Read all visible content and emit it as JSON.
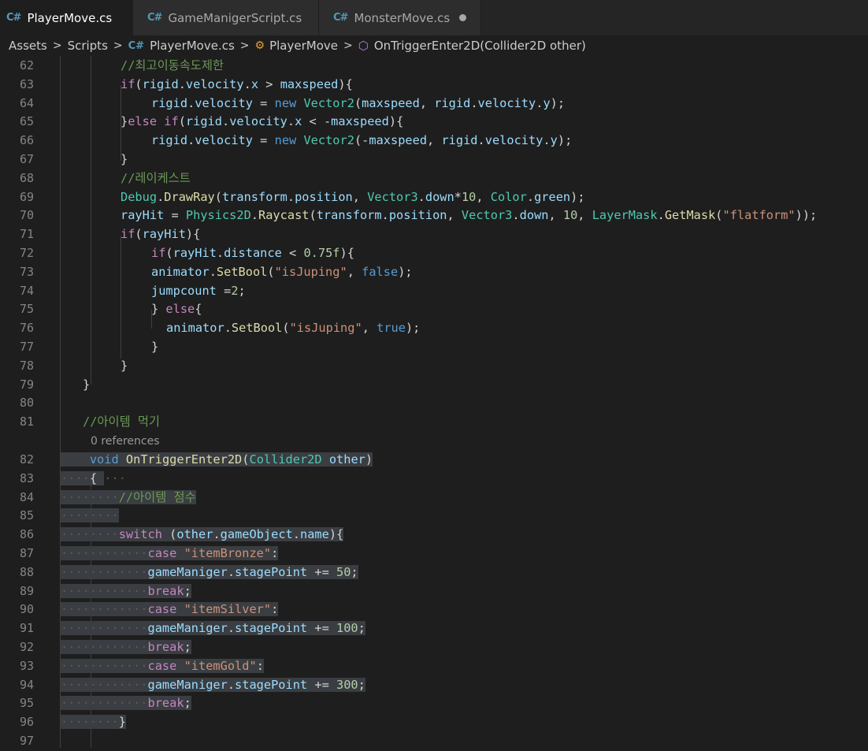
{
  "tabs": [
    {
      "label": "PlayerMove.cs",
      "icon": "csharp-icon",
      "active": true,
      "modified": true
    },
    {
      "label": "GameManigerScript.cs",
      "icon": "csharp-icon",
      "active": false,
      "modified": false
    },
    {
      "label": "MonsterMove.cs",
      "icon": "csharp-icon",
      "active": false,
      "modified": true
    }
  ],
  "breadcrumb": {
    "items": [
      "Assets",
      "Scripts",
      "PlayerMove.cs",
      "PlayerMove",
      "OnTriggerEnter2D(Collider2D other)"
    ]
  },
  "codelens": "0 references",
  "colors": {
    "keyword": "#c586c0",
    "keyword_blue": "#569cd6",
    "type": "#4ec9b0",
    "function": "#dcdcaa",
    "variable": "#9cdcfe",
    "string": "#ce9178",
    "number": "#b5cea8",
    "comment": "#6a9955",
    "selection": "#3a3d41"
  },
  "lines": [
    {
      "n": "62",
      "t": [
        [
          "c",
          "//최고이동속도제한"
        ]
      ]
    },
    {
      "n": "63",
      "t": [
        [
          "k",
          "if"
        ],
        [
          "p",
          "("
        ],
        [
          "v",
          "rigid"
        ],
        [
          "p",
          "."
        ],
        [
          "v",
          "velocity"
        ],
        [
          "p",
          "."
        ],
        [
          "v",
          "x"
        ],
        [
          "p",
          " > "
        ],
        [
          "v",
          "maxspeed"
        ],
        [
          "p",
          "){"
        ]
      ]
    },
    {
      "n": "64",
      "t": [
        [
          "v",
          "rigid"
        ],
        [
          "p",
          "."
        ],
        [
          "v",
          "velocity"
        ],
        [
          "p",
          " = "
        ],
        [
          "kb",
          "new"
        ],
        [
          "p",
          " "
        ],
        [
          "t",
          "Vector2"
        ],
        [
          "p",
          "("
        ],
        [
          "v",
          "maxspeed"
        ],
        [
          "p",
          ", "
        ],
        [
          "v",
          "rigid"
        ],
        [
          "p",
          "."
        ],
        [
          "v",
          "velocity"
        ],
        [
          "p",
          "."
        ],
        [
          "v",
          "y"
        ],
        [
          "p",
          ");"
        ]
      ]
    },
    {
      "n": "65",
      "t": [
        [
          "p",
          "}"
        ],
        [
          "k",
          "else"
        ],
        [
          "p",
          " "
        ],
        [
          "k",
          "if"
        ],
        [
          "p",
          "("
        ],
        [
          "v",
          "rigid"
        ],
        [
          "p",
          "."
        ],
        [
          "v",
          "velocity"
        ],
        [
          "p",
          "."
        ],
        [
          "v",
          "x"
        ],
        [
          "p",
          " < -"
        ],
        [
          "v",
          "maxspeed"
        ],
        [
          "p",
          "){"
        ]
      ]
    },
    {
      "n": "66",
      "t": [
        [
          "v",
          "rigid"
        ],
        [
          "p",
          "."
        ],
        [
          "v",
          "velocity"
        ],
        [
          "p",
          " = "
        ],
        [
          "kb",
          "new"
        ],
        [
          "p",
          " "
        ],
        [
          "t",
          "Vector2"
        ],
        [
          "p",
          "(-"
        ],
        [
          "v",
          "maxspeed"
        ],
        [
          "p",
          ", "
        ],
        [
          "v",
          "rigid"
        ],
        [
          "p",
          "."
        ],
        [
          "v",
          "velocity"
        ],
        [
          "p",
          "."
        ],
        [
          "v",
          "y"
        ],
        [
          "p",
          ");"
        ]
      ]
    },
    {
      "n": "67",
      "t": [
        [
          "p",
          "}"
        ]
      ]
    },
    {
      "n": "68",
      "t": [
        [
          "c",
          "//레이케스트"
        ]
      ]
    },
    {
      "n": "69",
      "t": [
        [
          "t",
          "Debug"
        ],
        [
          "p",
          "."
        ],
        [
          "f",
          "DrawRay"
        ],
        [
          "p",
          "("
        ],
        [
          "v",
          "transform"
        ],
        [
          "p",
          "."
        ],
        [
          "v",
          "position"
        ],
        [
          "p",
          ", "
        ],
        [
          "t",
          "Vector3"
        ],
        [
          "p",
          "."
        ],
        [
          "v",
          "down"
        ],
        [
          "p",
          "*"
        ],
        [
          "n",
          "10"
        ],
        [
          "p",
          ", "
        ],
        [
          "t",
          "Color"
        ],
        [
          "p",
          "."
        ],
        [
          "v",
          "green"
        ],
        [
          "p",
          ");"
        ]
      ]
    },
    {
      "n": "70",
      "t": [
        [
          "v",
          "rayHit"
        ],
        [
          "p",
          " = "
        ],
        [
          "t",
          "Physics2D"
        ],
        [
          "p",
          "."
        ],
        [
          "f",
          "Raycast"
        ],
        [
          "p",
          "("
        ],
        [
          "v",
          "transform"
        ],
        [
          "p",
          "."
        ],
        [
          "v",
          "position"
        ],
        [
          "p",
          ", "
        ],
        [
          "t",
          "Vector3"
        ],
        [
          "p",
          "."
        ],
        [
          "v",
          "down"
        ],
        [
          "p",
          ", "
        ],
        [
          "n",
          "10"
        ],
        [
          "p",
          ", "
        ],
        [
          "t",
          "LayerMask"
        ],
        [
          "p",
          "."
        ],
        [
          "f",
          "GetMask"
        ],
        [
          "p",
          "("
        ],
        [
          "s",
          "\"flatform\""
        ],
        [
          "p",
          "));"
        ]
      ]
    },
    {
      "n": "71",
      "t": [
        [
          "k",
          "if"
        ],
        [
          "p",
          "("
        ],
        [
          "v",
          "rayHit"
        ],
        [
          "p",
          "){"
        ]
      ]
    },
    {
      "n": "72",
      "t": [
        [
          "k",
          "if"
        ],
        [
          "p",
          "("
        ],
        [
          "v",
          "rayHit"
        ],
        [
          "p",
          "."
        ],
        [
          "v",
          "distance"
        ],
        [
          "p",
          " < "
        ],
        [
          "n",
          "0.75f"
        ],
        [
          "p",
          "){"
        ]
      ]
    },
    {
      "n": "73",
      "t": [
        [
          "v",
          "animator"
        ],
        [
          "p",
          "."
        ],
        [
          "f",
          "SetBool"
        ],
        [
          "p",
          "("
        ],
        [
          "s",
          "\"isJuping\""
        ],
        [
          "p",
          ", "
        ],
        [
          "kb",
          "false"
        ],
        [
          "p",
          ");"
        ]
      ]
    },
    {
      "n": "74",
      "t": [
        [
          "v",
          "jumpcount"
        ],
        [
          "p",
          " ="
        ],
        [
          "n",
          "2"
        ],
        [
          "p",
          ";"
        ]
      ]
    },
    {
      "n": "75",
      "t": [
        [
          "p",
          "} "
        ],
        [
          "k",
          "else"
        ],
        [
          "p",
          "{"
        ]
      ]
    },
    {
      "n": "76",
      "t": [
        [
          "v",
          "animator"
        ],
        [
          "p",
          "."
        ],
        [
          "f",
          "SetBool"
        ],
        [
          "p",
          "("
        ],
        [
          "s",
          "\"isJuping\""
        ],
        [
          "p",
          ", "
        ],
        [
          "kb",
          "true"
        ],
        [
          "p",
          ");"
        ]
      ]
    },
    {
      "n": "77",
      "t": [
        [
          "p",
          "}"
        ]
      ]
    },
    {
      "n": "78",
      "t": [
        [
          "p",
          "}"
        ]
      ]
    },
    {
      "n": "79",
      "t": [
        [
          "p",
          "}"
        ]
      ]
    },
    {
      "n": "80",
      "t": []
    },
    {
      "n": "81",
      "t": [
        [
          "c",
          "//아이템 먹기"
        ]
      ]
    },
    {
      "n": "82",
      "t": [
        [
          "kb",
          "void"
        ],
        [
          "p",
          " "
        ],
        [
          "f",
          "OnTriggerEnter2D"
        ],
        [
          "p",
          "("
        ],
        [
          "t",
          "Collider2D"
        ],
        [
          "p",
          " "
        ],
        [
          "v",
          "other"
        ],
        [
          "p",
          ")"
        ]
      ]
    },
    {
      "n": "83",
      "t": [
        [
          "p",
          "{"
        ]
      ]
    },
    {
      "n": "84",
      "t": [
        [
          "c",
          "//아이템 점수"
        ]
      ]
    },
    {
      "n": "85",
      "t": []
    },
    {
      "n": "86",
      "t": [
        [
          "k",
          "switch"
        ],
        [
          "p",
          " ("
        ],
        [
          "v",
          "other"
        ],
        [
          "p",
          "."
        ],
        [
          "v",
          "gameObject"
        ],
        [
          "p",
          "."
        ],
        [
          "v",
          "name"
        ],
        [
          "p",
          "){"
        ]
      ]
    },
    {
      "n": "87",
      "t": [
        [
          "k",
          "case"
        ],
        [
          "p",
          " "
        ],
        [
          "s",
          "\"itemBronze\""
        ],
        [
          "p",
          ":"
        ]
      ]
    },
    {
      "n": "88",
      "t": [
        [
          "v",
          "gameManiger"
        ],
        [
          "p",
          "."
        ],
        [
          "v",
          "stagePoint"
        ],
        [
          "p",
          " += "
        ],
        [
          "n",
          "50"
        ],
        [
          "p",
          ";"
        ]
      ]
    },
    {
      "n": "89",
      "t": [
        [
          "k",
          "break"
        ],
        [
          "p",
          ";"
        ]
      ]
    },
    {
      "n": "90",
      "t": [
        [
          "k",
          "case"
        ],
        [
          "p",
          " "
        ],
        [
          "s",
          "\"itemSilver\""
        ],
        [
          "p",
          ":"
        ]
      ]
    },
    {
      "n": "91",
      "t": [
        [
          "v",
          "gameManiger"
        ],
        [
          "p",
          "."
        ],
        [
          "v",
          "stagePoint"
        ],
        [
          "p",
          " += "
        ],
        [
          "n",
          "100"
        ],
        [
          "p",
          ";"
        ]
      ]
    },
    {
      "n": "92",
      "t": [
        [
          "k",
          "break"
        ],
        [
          "p",
          ";"
        ]
      ]
    },
    {
      "n": "93",
      "t": [
        [
          "k",
          "case"
        ],
        [
          "p",
          " "
        ],
        [
          "s",
          "\"itemGold\""
        ],
        [
          "p",
          ":"
        ]
      ]
    },
    {
      "n": "94",
      "t": [
        [
          "v",
          "gameManiger"
        ],
        [
          "p",
          "."
        ],
        [
          "v",
          "stagePoint"
        ],
        [
          "p",
          " += "
        ],
        [
          "n",
          "300"
        ],
        [
          "p",
          ";"
        ]
      ]
    },
    {
      "n": "95",
      "t": [
        [
          "k",
          "break"
        ],
        [
          "p",
          ";"
        ]
      ]
    },
    {
      "n": "96",
      "t": [
        [
          "p",
          "}"
        ]
      ]
    },
    {
      "n": "97",
      "t": []
    }
  ]
}
